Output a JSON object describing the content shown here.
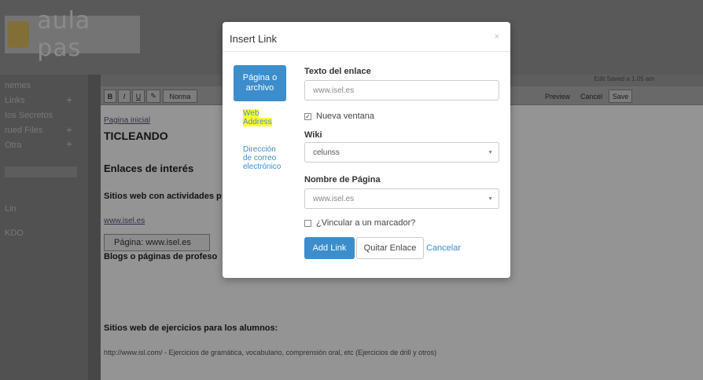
{
  "app": {
    "logo_text": "aula pas"
  },
  "sidebar": {
    "items": [
      {
        "label": "nemes"
      },
      {
        "label": "Links"
      },
      {
        "label": "Ios Secretos"
      },
      {
        "label": "rued Files"
      },
      {
        "label": "Otra"
      },
      {
        "label": "Lin"
      },
      {
        "label": "KDO"
      }
    ]
  },
  "editor": {
    "toolbar": {
      "bold": "B",
      "italic": "I",
      "underline": "U",
      "format": "Norma",
      "preview": "Preview",
      "cancel": "Cancel",
      "save": "Save"
    },
    "hint": "Edit Saved a 1.05 am"
  },
  "document": {
    "link_top": "Pagina inicial",
    "title": "TICLEANDO",
    "heading": "Enlaces de interés",
    "sub1": "Sitios web con actividades p",
    "link2": "www.isel.es",
    "page_box": "Página: www.isel.es",
    "sub2": "Blogs o páginas de profeso",
    "sub3": "Sitios web de ejercicios para los alumnos:",
    "footer_line": "http://www.isl.com/ - Ejercicios de gramática, vocabulario, comprensión oral, etc (Ejercicios de drill y otros)"
  },
  "modal": {
    "title": "Insert Link",
    "close": "×",
    "nav": {
      "page_or_file": "Página o archivo",
      "web_address": "Web Address",
      "email": "Dirección de correo electrónico"
    },
    "link_text_label": "Texto del enlace",
    "link_text_value": "www.isel.es",
    "new_window_label": "Nueva ventana",
    "wiki_label": "Wiki",
    "wiki_value": "celunss",
    "page_name_label": "Nombre de Página",
    "page_name_value": "www.isel.es",
    "bookmark_label": "¿Vincular a un marcador?",
    "add_link": "Add Link",
    "remove_link": "Quitar Enlace",
    "cancel": "Cancelar"
  }
}
